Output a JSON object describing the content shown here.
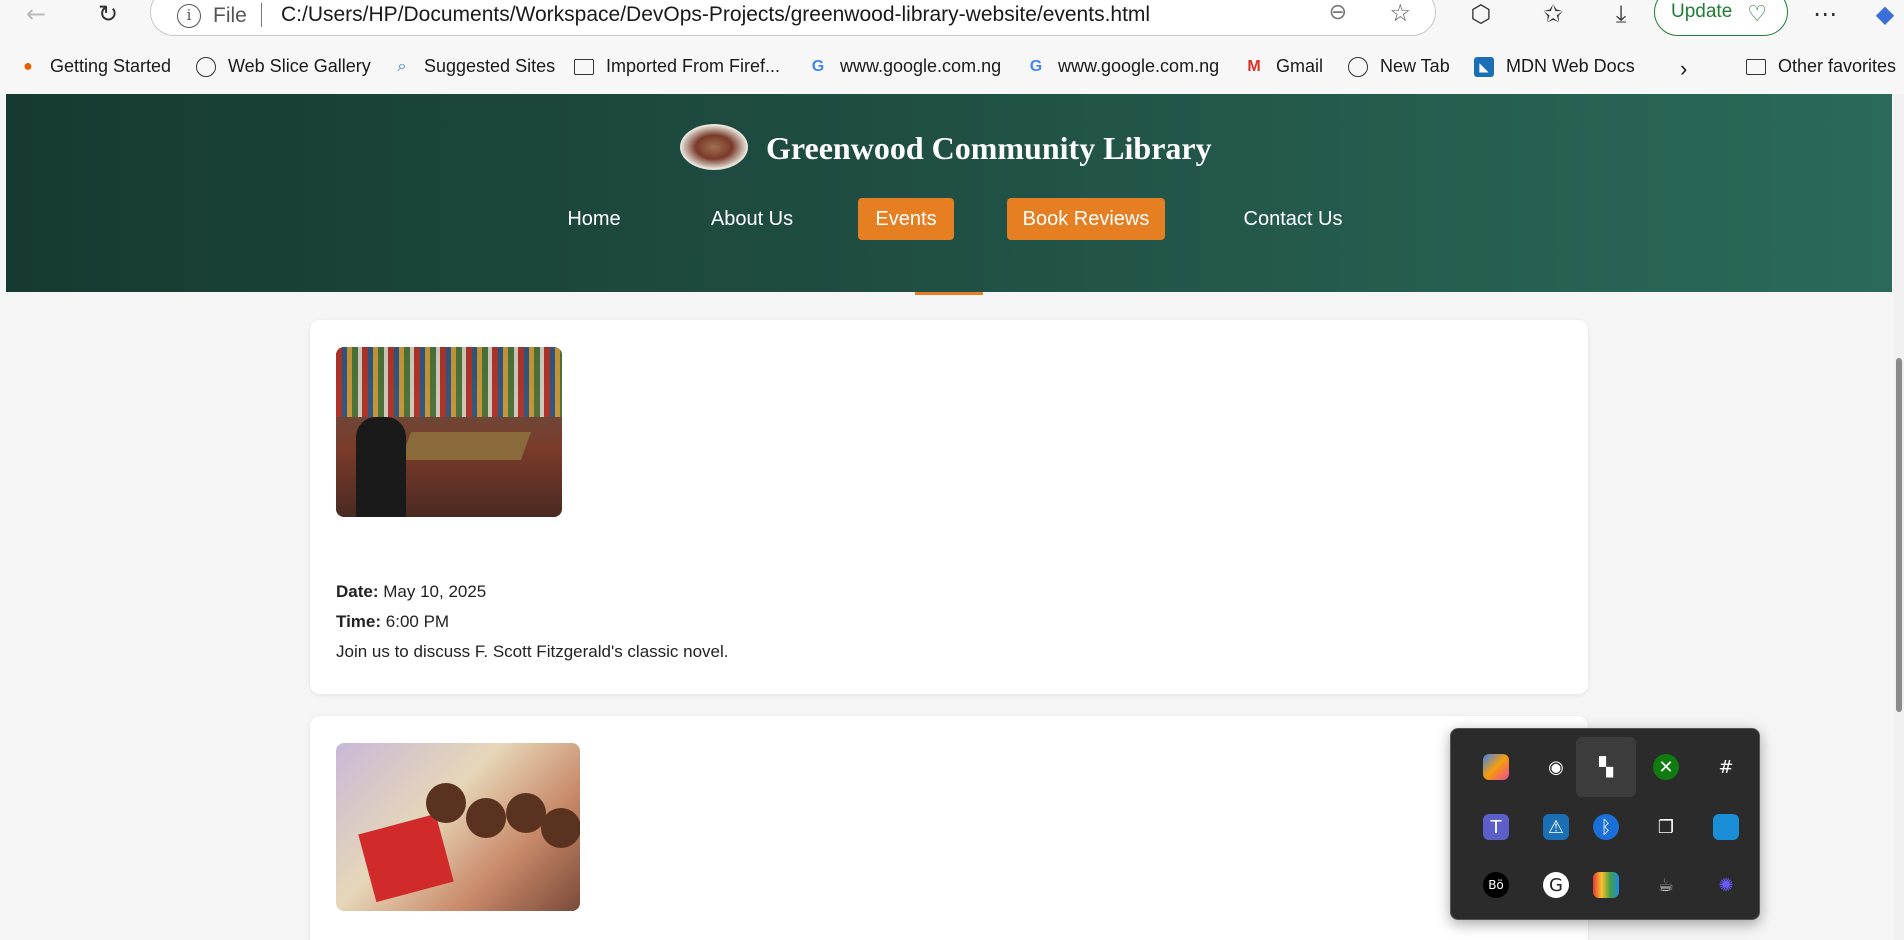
{
  "browser": {
    "address": {
      "scheme": "File",
      "url": "C:/Users/HP/Documents/Workspace/DevOps-Projects/greenwood-library-website/events.html"
    },
    "update_label": "Update",
    "bookmarks": [
      {
        "label": "Getting Started",
        "icon": "firefox-icon"
      },
      {
        "label": "Web Slice Gallery",
        "icon": "globe-icon"
      },
      {
        "label": "Suggested Sites",
        "icon": "search-icon"
      },
      {
        "label": "Imported From Firef...",
        "icon": "folder-icon"
      },
      {
        "label": "www.google.com.ng",
        "icon": "google-icon"
      },
      {
        "label": "www.google.com.ng",
        "icon": "google-icon"
      },
      {
        "label": "Gmail",
        "icon": "gmail-icon"
      },
      {
        "label": "New Tab",
        "icon": "globe-icon"
      },
      {
        "label": "MDN Web Docs",
        "icon": "mdn-icon"
      },
      {
        "label": "Other favorites",
        "icon": "folder-icon"
      }
    ]
  },
  "site": {
    "title": "Greenwood Community Library",
    "nav": [
      {
        "label": "Home",
        "active": false
      },
      {
        "label": "About Us",
        "active": false
      },
      {
        "label": "Events",
        "active": true
      },
      {
        "label": "Book Reviews",
        "active": true
      },
      {
        "label": "Contact Us",
        "active": false
      }
    ]
  },
  "events": [
    {
      "date_label": "Date:",
      "date": "May 10, 2025",
      "time_label": "Time:",
      "time": "6:00 PM",
      "description": "Join us to discuss F. Scott Fitzgerald's classic novel."
    }
  ],
  "tray": {
    "icons": [
      "copilot-icon",
      "discord-icon",
      "bookmark-app-icon",
      "xbox-icon",
      "slack-icon",
      "teams-icon",
      "security-warning-icon",
      "bluetooth-icon",
      "copy-icon",
      "app-box-icon",
      "beats-icon",
      "grammarly-icon",
      "palette-app-icon",
      "cup-icon",
      "gear-flower-icon"
    ]
  },
  "colors": {
    "header_start": "#163a31",
    "header_end": "#2a6a5a",
    "accent": "#e67e22",
    "update_green": "#1e7e34"
  }
}
